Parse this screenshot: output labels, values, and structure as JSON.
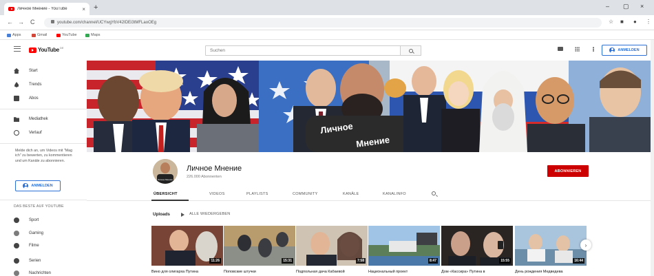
{
  "browser": {
    "tab_title": "Личное Мнение - YouTube",
    "tab_close": "×",
    "new_tab": "+",
    "url": "youtube.com/channel/UCYwgYbV42IDEi3tMFLaoOEg",
    "window_controls": [
      "–",
      "▢",
      "×"
    ],
    "nav": {
      "back": "←",
      "forward": "→",
      "reload": "C"
    },
    "address_icons": [
      "☆",
      "■",
      "●",
      "⋮"
    ],
    "bookmarks": [
      {
        "label": "Apps",
        "color": "#4a7fd6"
      },
      {
        "label": "Gmail",
        "color": "#d44638"
      },
      {
        "label": "YouTube",
        "color": "#ff0000"
      },
      {
        "label": "Maps",
        "color": "#34a853"
      }
    ]
  },
  "header": {
    "logo_text": "YouTube",
    "logo_suffix": "DE",
    "search_placeholder": "Suchen",
    "signin_label": "ANMELDEN"
  },
  "sidebar": {
    "primary": [
      {
        "label": "Start",
        "icon": "home-icon"
      },
      {
        "label": "Trends",
        "icon": "trending-icon"
      },
      {
        "label": "Abos",
        "icon": "subscriptions-icon"
      }
    ],
    "secondary": [
      {
        "label": "Mediathek",
        "icon": "library-icon"
      },
      {
        "label": "Verlauf",
        "icon": "history-icon"
      }
    ],
    "signin_note": "Melde dich an, um Videos mit \"Mag ich\" zu bewerten, zu kommentieren und um Kanäle zu abonnieren.",
    "signin_label": "ANMELDEN",
    "best_heading": "DAS BESTE AUF YOUTUBE",
    "best": [
      {
        "label": "Sport",
        "icon": "sports-icon"
      },
      {
        "label": "Gaming",
        "icon": "gaming-icon"
      },
      {
        "label": "Filme",
        "icon": "movies-icon"
      },
      {
        "label": "Serien",
        "icon": "tv-icon"
      },
      {
        "label": "Nachrichten",
        "icon": "news-icon"
      }
    ]
  },
  "banner": {
    "shirt_text_1": "Личное",
    "shirt_text_2": "Мнение"
  },
  "channel": {
    "name": "Личное Мнение",
    "subscribers": "226.000 Abonnenten",
    "subscribe_label": "ABONNIEREN",
    "avatar_text": "Личное Мнение"
  },
  "tabs": [
    "ÜBERSICHT",
    "VIDEOS",
    "PLAYLISTS",
    "COMMUNITY",
    "KANÄLE",
    "KANALINFO"
  ],
  "uploads": {
    "heading": "Uploads",
    "play_all": "ALLE WIEDERGEBEN",
    "next": "›",
    "videos": [
      {
        "title": "Вино для олигарха Путина",
        "duration": "11:26"
      },
      {
        "title": "Поповские штучки",
        "duration": "15:31"
      },
      {
        "title": "Подпольная дача Кабаевой",
        "duration": "7:58"
      },
      {
        "title": "Национальный проект",
        "duration": "8:47"
      },
      {
        "title": "Дом «Кассира» Путина в",
        "duration": "15:55"
      },
      {
        "title": "День рождения Медведева",
        "duration": "16:44"
      }
    ]
  },
  "colors": {
    "accent": "#2a6fd6",
    "subscribe": "#cc0000",
    "youtube_red": "#ff0000"
  }
}
